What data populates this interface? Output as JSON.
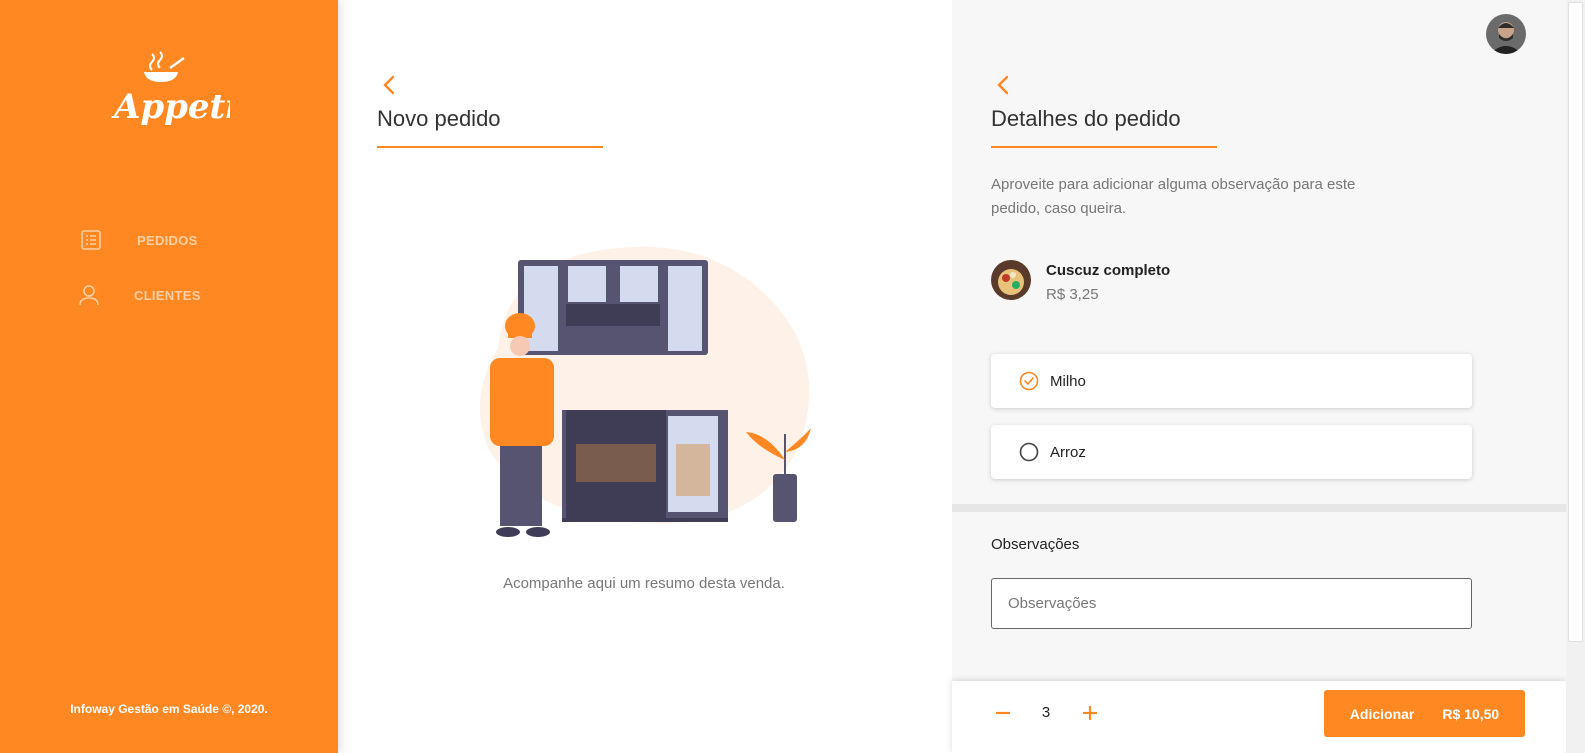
{
  "brand": {
    "logo_text": "Appetit",
    "accent_color": "#ff8822"
  },
  "sidebar": {
    "items": [
      {
        "label": "PEDIDOS",
        "icon": "list-icon"
      },
      {
        "label": "CLIENTES",
        "icon": "user-icon"
      }
    ],
    "footer": "Infoway Gestão em Saúde ©, 2020."
  },
  "new_order": {
    "title": "Novo pedido",
    "summary_text": "Acompanhe aqui um resumo desta venda."
  },
  "order_details": {
    "title": "Detalhes do pedido",
    "description": "Aproveite para adicionar alguma observação para este pedido, caso queira.",
    "product": {
      "name": "Cuscuz completo",
      "price": "R$ 3,25"
    },
    "options": [
      {
        "label": "Milho",
        "selected": true
      },
      {
        "label": "Arroz",
        "selected": false
      }
    ],
    "observations_label": "Observações",
    "observations_placeholder": "Observações",
    "quantity": "3",
    "add_label": "Adicionar",
    "total": "R$ 10,50"
  }
}
